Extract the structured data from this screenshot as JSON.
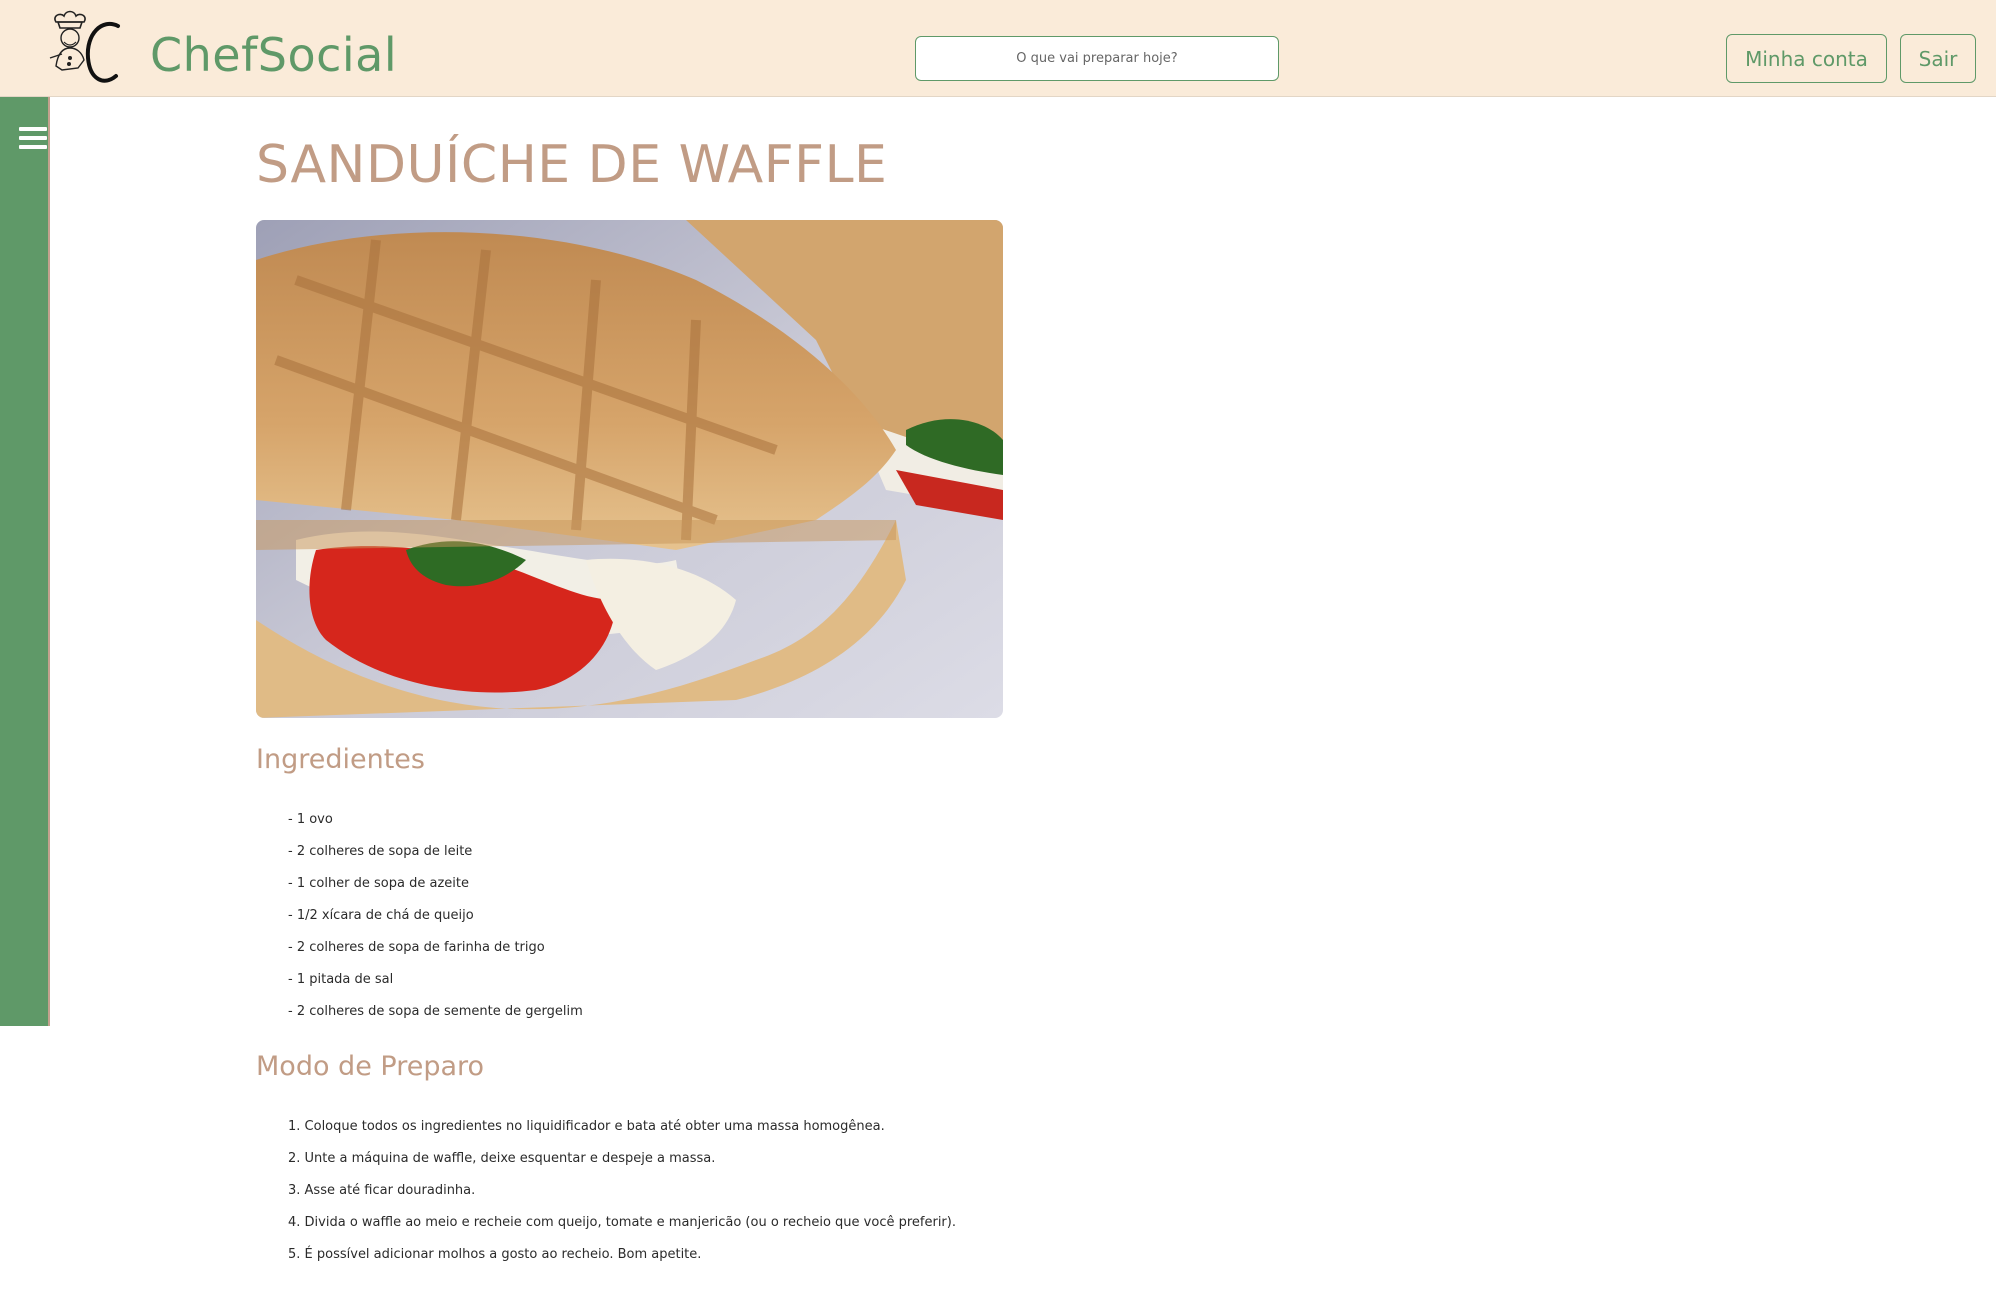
{
  "header": {
    "brand": "ChefSocial",
    "search_placeholder": "O que vai preparar hoje?",
    "account_label": "Minha conta",
    "exit_label": "Sair"
  },
  "sidebar": {
    "menu_icon": "hamburger-menu-icon"
  },
  "recipe": {
    "title": "SANDUÍCHE DE WAFFLE",
    "image_subject": "waffle sandwich with tomato, cheese and basil",
    "ingredients_heading": "Ingredientes",
    "ingredients": [
      "- 1 ovo",
      "- 2 colheres de sopa de leite",
      "- 1 colher de sopa de azeite",
      "- 1/2 xícara de chá de queijo",
      "- 2 colheres de sopa de farinha de trigo",
      "- 1 pitada de sal",
      "- 2 colheres de sopa de semente de gergelim"
    ],
    "method_heading": "Modo de Preparo",
    "method": [
      "1. Coloque todos os ingredientes no liquidificador e bata até obter uma massa homogênea.",
      "2. Unte a máquina de waffle, deixe esquentar e despeje a massa.",
      "3. Asse até ficar douradinha.",
      "4. Divida o waffle ao meio e recheie com queijo, tomate e manjericão (ou o recheio que você preferir).",
      "5. É possível adicionar molhos a gosto ao recheio. Bom apetite."
    ]
  },
  "colors": {
    "header_bg": "#faebd9",
    "brand_green": "#5f9968",
    "heading_tan": "#c19c85"
  }
}
